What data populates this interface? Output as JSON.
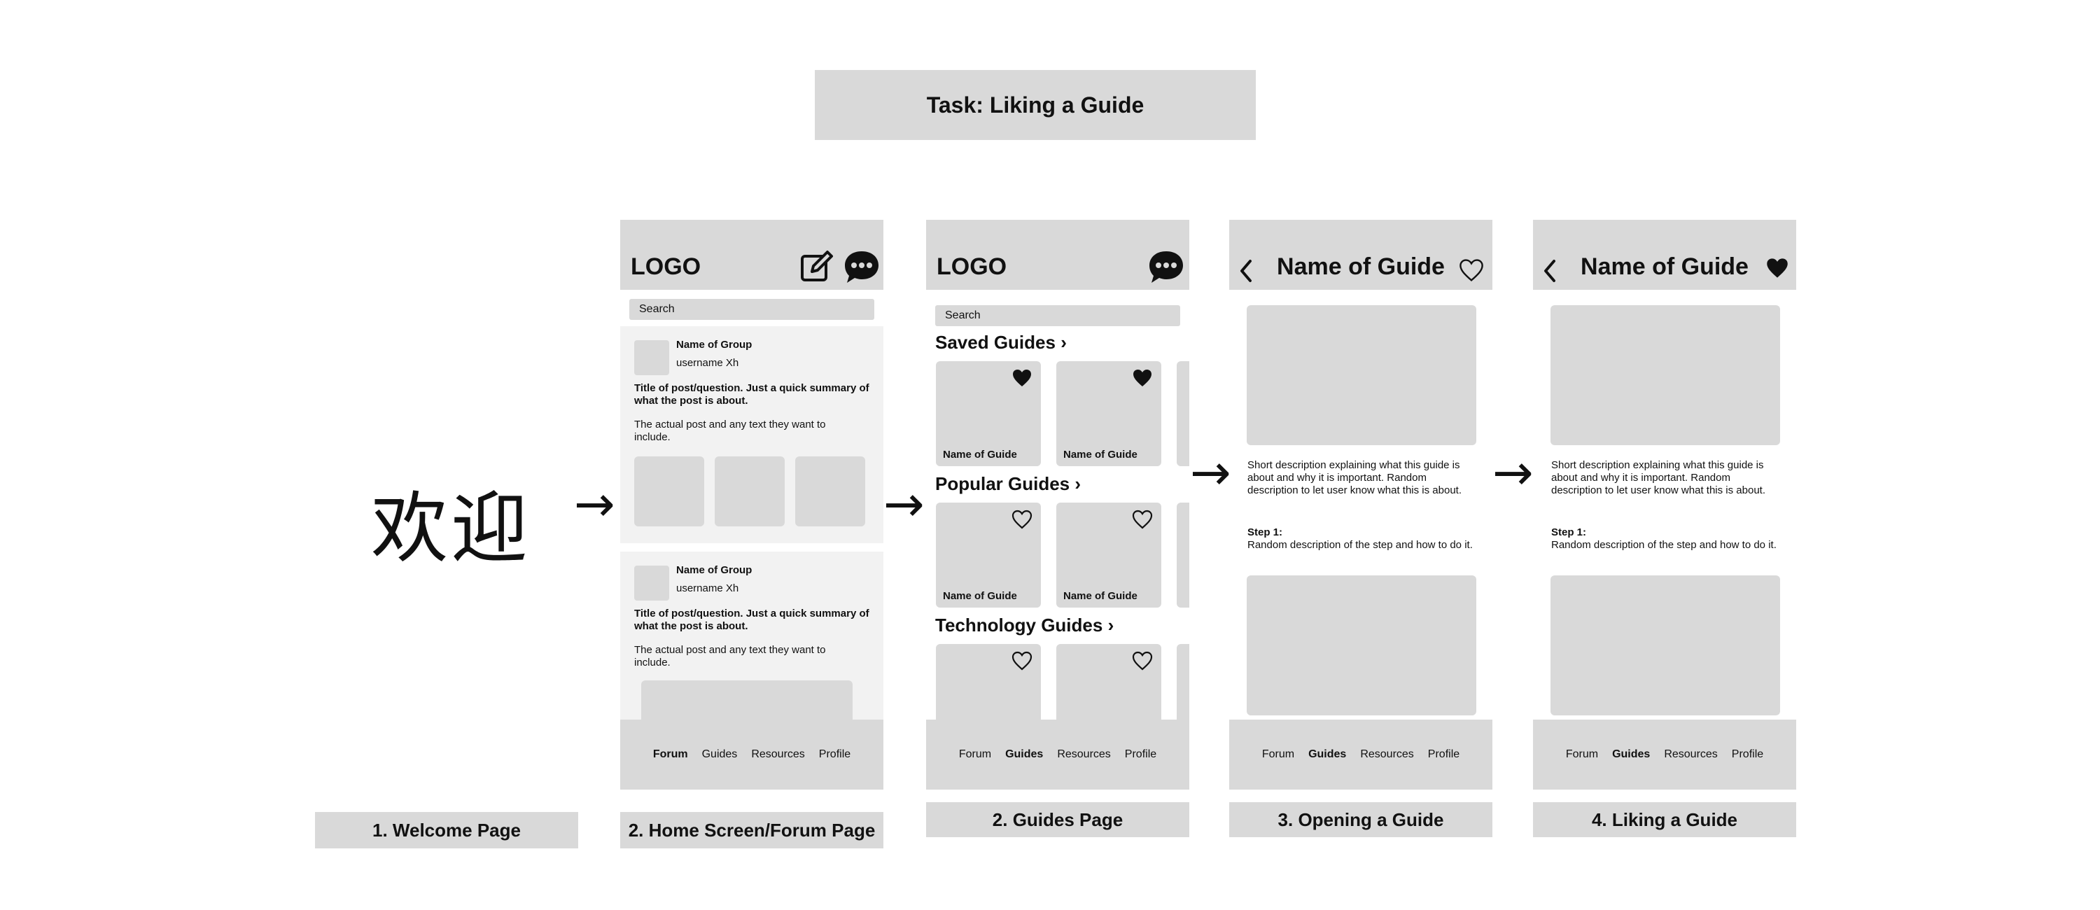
{
  "task_title": "Task: Liking a Guide",
  "welcome": {
    "text": "欢迎"
  },
  "captions": {
    "welcome": "1.  Welcome Page",
    "forum": "2. Home Screen/Forum Page",
    "guides": "2. Guides Page",
    "opening": "3. Opening a Guide",
    "liking": "4. Liking a Guide"
  },
  "forum": {
    "logo": "LOGO",
    "search_placeholder": "Search",
    "posts": [
      {
        "group": "Name of Group",
        "user": "username   Xh",
        "title": "Title of post/question. Just a quick summary of what the post is about.",
        "body": "The actual post and any text they want to include."
      },
      {
        "group": "Name of Group",
        "user": "username   Xh",
        "title": "Title of post/question. Just a quick summary of what the post is about.",
        "body": "The actual post and any text they want to include."
      }
    ],
    "nav": [
      "Forum",
      "Guides",
      "Resources",
      "Profile"
    ],
    "nav_active": "Forum"
  },
  "guides": {
    "logo": "LOGO",
    "search_placeholder": "Search",
    "sections": [
      {
        "title": "Saved Guides",
        "liked": true
      },
      {
        "title": "Popular Guides",
        "liked": false
      },
      {
        "title": "Technology Guides",
        "liked": false
      }
    ],
    "card_name": "Name of Guide",
    "nav": [
      "Forum",
      "Guides",
      "Resources",
      "Profile"
    ],
    "nav_active": "Guides"
  },
  "guide_detail": {
    "title": "Name of Guide",
    "description": "Short description explaining what this guide is about and why it is important. Random description to let user know what this is about.",
    "step_label": "Step 1:",
    "step_text": "Random description of the step and how to do it.",
    "nav": [
      "Forum",
      "Guides",
      "Resources",
      "Profile"
    ],
    "nav_active": "Guides",
    "liked_before": false,
    "liked_after": true
  }
}
